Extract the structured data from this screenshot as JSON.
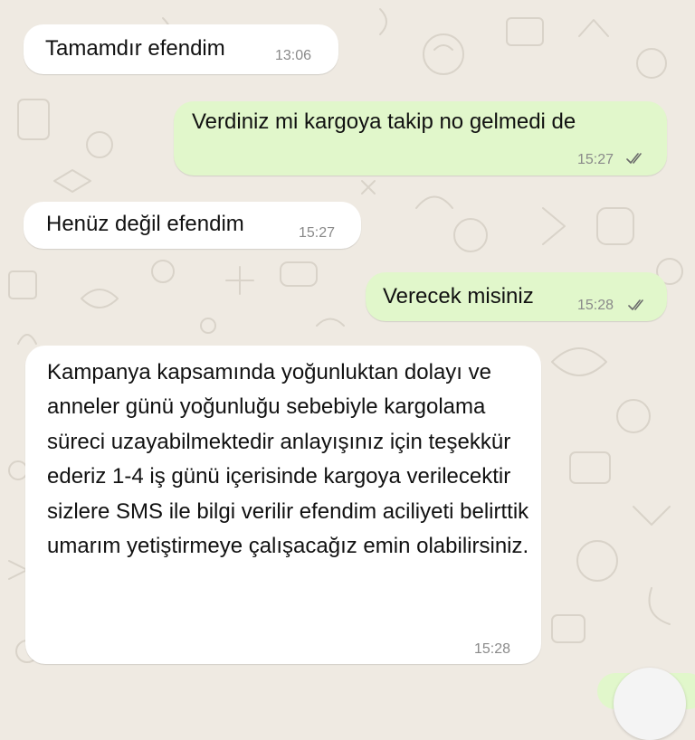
{
  "chat": {
    "messages": [
      {
        "direction": "incoming",
        "text": "Tamamdır efendim",
        "time": "13:06"
      },
      {
        "direction": "outgoing",
        "text": "Verdiniz mi kargoya takip no gelmedi de",
        "time": "15:27",
        "status": "read"
      },
      {
        "direction": "incoming",
        "text": "Henüz değil efendim",
        "time": "15:27"
      },
      {
        "direction": "outgoing",
        "text": "Verecek misiniz",
        "time": "15:28",
        "status": "read"
      },
      {
        "direction": "incoming",
        "text": "Kampanya kapsamında yoğunluktan dolayı ve anneler günü yoğunluğu sebebiyle kargolama süreci uzayabilmektedir anlayışınız için teşekkür ederiz 1-4 iş günü içerisinde kargoya verilecektir sizlere SMS ile bilgi verilir efendim aciliyeti belirttik umarım yetiştirmeye çalışacağız emin olabilirsiniz.",
        "time": "15:28"
      }
    ]
  },
  "colors": {
    "background": "#efeae2",
    "incoming_bubble": "#ffffff",
    "outgoing_bubble": "#e1f7cb",
    "timestamp": "#8a8a8a",
    "read_ticks": "#6b6b6b"
  },
  "icons": {
    "read_receipt": "double-check-icon",
    "wallpaper": "doodle-pattern"
  }
}
